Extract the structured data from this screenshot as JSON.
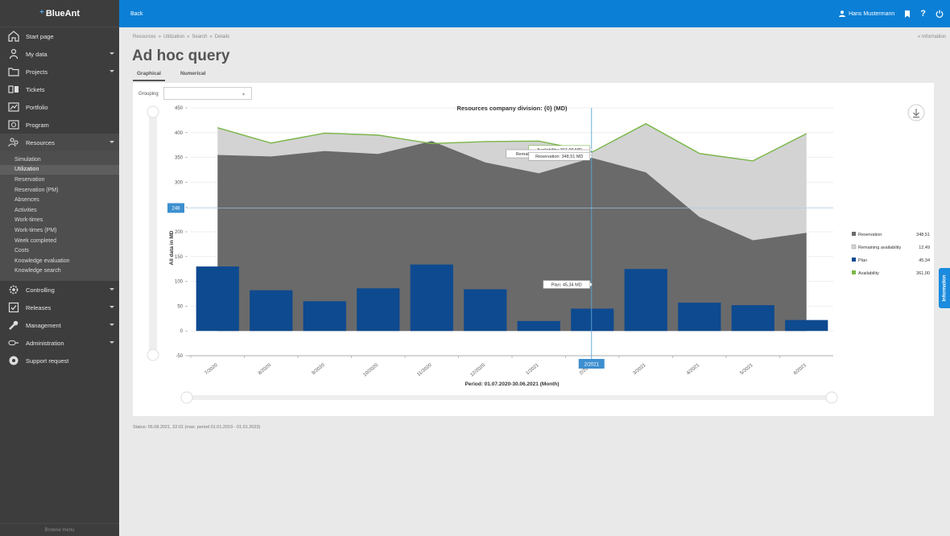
{
  "app": {
    "logo": "BlueAnt",
    "browse_menu": "Browse menu"
  },
  "topbar": {
    "back": "Back",
    "user": "Hans Mustermann"
  },
  "sidebar": {
    "items": [
      {
        "label": "Start page",
        "icon": "home-icon",
        "caret": false
      },
      {
        "label": "My data",
        "icon": "person-icon",
        "caret": true
      },
      {
        "label": "Projects",
        "icon": "folder-icon",
        "caret": true
      },
      {
        "label": "Tickets",
        "icon": "ticket-icon",
        "caret": false
      },
      {
        "label": "Portfolio",
        "icon": "portfolio-icon",
        "caret": false
      },
      {
        "label": "Program",
        "icon": "program-icon",
        "caret": false
      },
      {
        "label": "Resources",
        "icon": "resources-icon",
        "caret": true
      }
    ],
    "submenu": [
      "Simulation",
      "Utilization",
      "Reservation",
      "Reservation (PM)",
      "Absences",
      "Activities",
      "Work-times",
      "Work-times (PM)",
      "Week completed",
      "Costs",
      "Knowledge evaluation",
      "Knowledge search"
    ],
    "active_sub": "Utilization",
    "items_after": [
      {
        "label": "Controlling",
        "icon": "gear-icon",
        "caret": true
      },
      {
        "label": "Releases",
        "icon": "checkbox-icon",
        "caret": true
      },
      {
        "label": "Management",
        "icon": "wrench-icon",
        "caret": true
      },
      {
        "label": "Administration",
        "icon": "key-icon",
        "caret": true
      },
      {
        "label": "Support request",
        "icon": "support-icon",
        "caret": false
      }
    ]
  },
  "breadcrumb": [
    "Resources",
    "Utilization",
    "Search",
    "Details"
  ],
  "info_link": "« Information",
  "page_title": "Ad hoc query",
  "tabs": [
    "Graphical",
    "Numerical"
  ],
  "grouping_label": "Grouping",
  "info_tab": "Information",
  "status": "Status: 06.08.2021, 22:01 (max. period 01.01.2019 - 01.01.2023)",
  "colors": {
    "reservation": "#6a6a6a",
    "remaining": "#d3d3d3",
    "plan": "#0e4a8f",
    "availability": "#7ab648",
    "topbar": "#0b7fd6"
  },
  "chart_data": {
    "type": "bar",
    "title": "Resources company division: {0} (MD)",
    "xlabel": "Period: 01.07.2020-30.06.2021 (Month)",
    "ylabel": "All data in MD",
    "ylim": [
      -50,
      450
    ],
    "yticks": [
      -50,
      0,
      50,
      100,
      150,
      200,
      250,
      300,
      350,
      400,
      450
    ],
    "categories": [
      "7/2020",
      "8/2020",
      "9/2020",
      "10/2020",
      "11/2020",
      "12/2020",
      "1/2021",
      "2/2021",
      "3/2021",
      "4/2021",
      "5/2021",
      "6/2021"
    ],
    "series": [
      {
        "name": "Reservation",
        "type": "area",
        "values": [
          355,
          352,
          363,
          357,
          383,
          340,
          318,
          349,
          320,
          230,
          183,
          198
        ]
      },
      {
        "name": "Remaining availability",
        "type": "area-stacked",
        "values": [
          55,
          27,
          36,
          38,
          0,
          42,
          65,
          12,
          98,
          128,
          160,
          200
        ]
      },
      {
        "name": "Plan",
        "type": "bar",
        "values": [
          130,
          82,
          60,
          86,
          134,
          84,
          20,
          45,
          125,
          57,
          52,
          22
        ]
      },
      {
        "name": "Availability",
        "type": "line",
        "values": [
          410,
          379,
          399,
          395,
          378,
          382,
          383,
          361,
          418,
          358,
          343,
          398
        ]
      }
    ],
    "legend": [
      {
        "label": "Reservation",
        "value": "348,51"
      },
      {
        "label": "Remaining availability",
        "value": "12,49"
      },
      {
        "label": "Plan",
        "value": "45,34"
      },
      {
        "label": "Availability",
        "value": "361,00"
      }
    ],
    "legend_position": "right",
    "crosshair": {
      "category": "2/2021",
      "y_value": 248,
      "y_label": "248"
    },
    "tooltips": [
      "Availability: 361,00 MD",
      "Remaining availability: 12,49 MD",
      "Reservation: 348,51 MD",
      "Plan: 45,34 MD"
    ]
  }
}
